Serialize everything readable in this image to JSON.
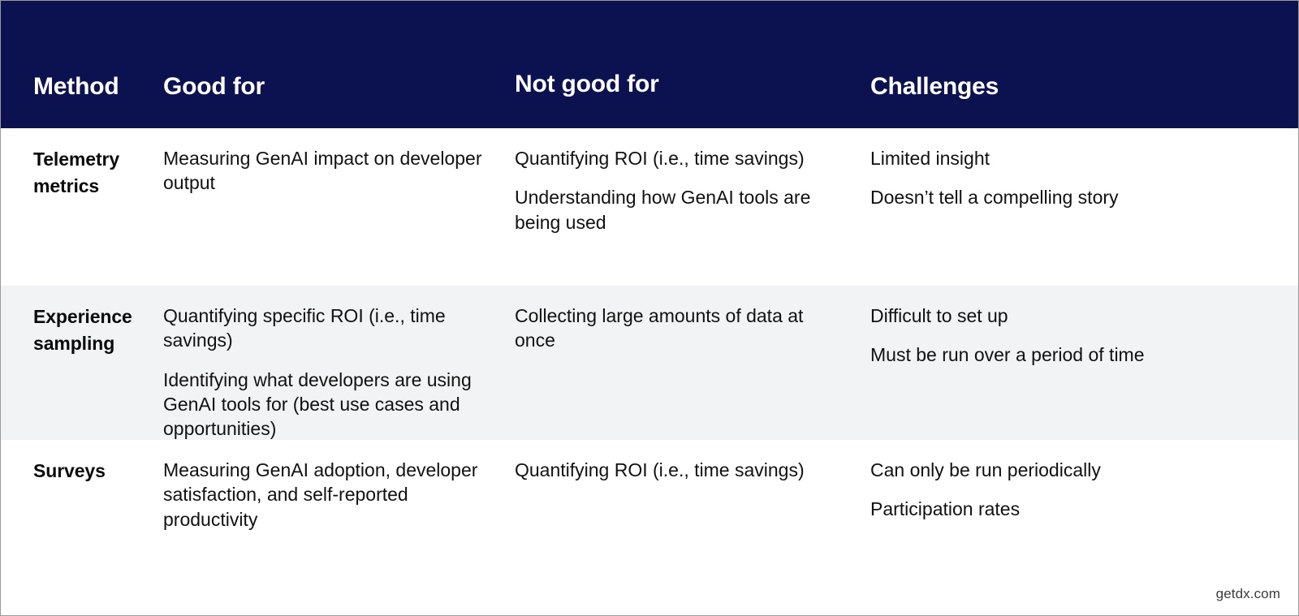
{
  "table": {
    "headers": [
      {
        "label": "Method"
      },
      {
        "label": "Good for"
      },
      {
        "label": "Not good for"
      },
      {
        "label": "Challenges"
      }
    ],
    "rows": [
      {
        "method": "Telemetry metrics",
        "good_for": [
          "Measuring GenAI impact on developer output"
        ],
        "not_good_for": [
          "Quantifying ROI (i.e., time savings)",
          "Understanding how GenAI tools are being used"
        ],
        "challenges": [
          "Limited insight",
          "Doesn’t tell a compelling story"
        ]
      },
      {
        "method": "Experience sampling",
        "good_for": [
          "Quantifying specific ROI (i.e., time savings)",
          "Identifying what developers are using GenAI tools for (best use cases and opportunities)"
        ],
        "not_good_for": [
          "Collecting large amounts of data at once"
        ],
        "challenges": [
          "Difficult to set up",
          "Must be run over a period of time"
        ]
      },
      {
        "method": "Surveys",
        "good_for": [
          "Measuring GenAI adoption, developer satisfaction, and self-reported productivity"
        ],
        "not_good_for": [
          "Quantifying ROI (i.e., time savings)"
        ],
        "challenges": [
          "Can only be run periodically",
          "Participation rates"
        ]
      }
    ]
  },
  "footer": {
    "watermark": "getdx.com"
  },
  "colors": {
    "header_background": "#0c1150",
    "header_text": "#ffffff",
    "row_alt_background": "#f2f3f5",
    "row_background": "#ffffff",
    "body_text": "#111111",
    "frame_border": "#9a9a9a"
  }
}
